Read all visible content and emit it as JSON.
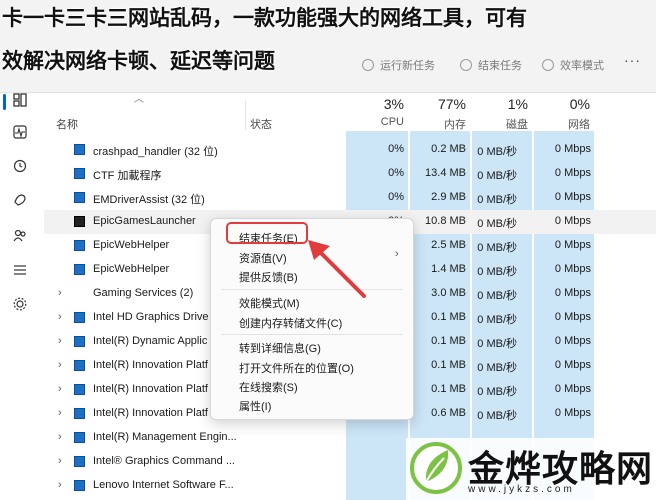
{
  "caption": {
    "line1": "卡一卡三卡三网站乱码，一款功能强大的网络工具，可有",
    "line2": "效解决网络卡顿、延迟等问题"
  },
  "toolbar": {
    "run_task": "运行新任务",
    "end_task": "结束任务",
    "efficiency": "效率模式",
    "more": "···"
  },
  "header": {
    "name": "名称",
    "status": "状态",
    "cpu_pct": "3%",
    "cpu": "CPU",
    "mem_pct": "77%",
    "mem": "内存",
    "disk_pct": "1%",
    "disk": "磁盘",
    "net_pct": "0%",
    "net": "网络"
  },
  "rows": [
    {
      "name": "crashpad_handler (32 位)",
      "cpu": "0%",
      "mem": "0.2 MB",
      "disk": "0 MB/秒",
      "net": "0 Mbps",
      "icon": "app-icon"
    },
    {
      "name": "CTF 加載程序",
      "cpu": "0%",
      "mem": "13.4 MB",
      "disk": "0 MB/秒",
      "net": "0 Mbps",
      "icon": "app-icon"
    },
    {
      "name": "EMDriverAssist (32 位)",
      "cpu": "0%",
      "mem": "2.9 MB",
      "disk": "0 MB/秒",
      "net": "0 Mbps",
      "icon": "app-icon"
    },
    {
      "name": "EpicGamesLauncher",
      "cpu": "0%",
      "mem": "10.8 MB",
      "disk": "0 MB/秒",
      "net": "0 Mbps",
      "icon": "epic-icon"
    },
    {
      "name": "EpicWebHelper",
      "cpu": "",
      "mem": "2.5 MB",
      "disk": "0 MB/秒",
      "net": "0 Mbps",
      "icon": "app-icon"
    },
    {
      "name": "EpicWebHelper",
      "cpu": "",
      "mem": "1.4 MB",
      "disk": "0 MB/秒",
      "net": "0 Mbps",
      "icon": "app-icon"
    },
    {
      "name": "Gaming Services (2)",
      "cpu": "",
      "mem": "3.0 MB",
      "disk": "0 MB/秒",
      "net": "0 Mbps",
      "icon": "none",
      "expand": true
    },
    {
      "name": "Intel HD Graphics Drive",
      "cpu": "",
      "mem": "0.1 MB",
      "disk": "0 MB/秒",
      "net": "0 Mbps",
      "icon": "app-icon",
      "expand": true
    },
    {
      "name": "Intel(R) Dynamic Applic",
      "cpu": "",
      "mem": "0.1 MB",
      "disk": "0 MB/秒",
      "net": "0 Mbps",
      "icon": "app-icon",
      "expand": true
    },
    {
      "name": "Intel(R) Innovation Platf",
      "cpu": "",
      "mem": "0.1 MB",
      "disk": "0 MB/秒",
      "net": "0 Mbps",
      "icon": "app-icon",
      "expand": true
    },
    {
      "name": "Intel(R) Innovation Platf",
      "cpu": "",
      "mem": "0.1 MB",
      "disk": "0 MB/秒",
      "net": "0 Mbps",
      "icon": "app-icon",
      "expand": true
    },
    {
      "name": "Intel(R) Innovation Platf",
      "cpu": "",
      "mem": "0.6 MB",
      "disk": "0 MB/秒",
      "net": "0 Mbps",
      "icon": "app-icon",
      "expand": true
    },
    {
      "name": "Intel(R) Management Engin...",
      "cpu": "",
      "mem": "",
      "disk": "",
      "net": "",
      "icon": "app-icon",
      "expand": true
    },
    {
      "name": "Intel® Graphics Command ...",
      "cpu": "",
      "mem": "",
      "disk": "",
      "net": "",
      "icon": "app-icon",
      "expand": true
    },
    {
      "name": "Lenovo Internet Software F...",
      "cpu": "",
      "mem": "",
      "disk": "",
      "net": "",
      "icon": "app-icon",
      "expand": true
    }
  ],
  "context_menu": {
    "end_task": "结束任务(E)",
    "resource_values": "资源值(V)",
    "feedback": "提供反馈(B)",
    "efficiency_mode": "效能模式(M)",
    "create_dump": "创建内存转储文件(C)",
    "go_details": "转到详细信息(G)",
    "open_location": "打开文件所在的位置(O)",
    "search_online": "在线搜索(S)",
    "properties": "属性(I)"
  },
  "watermark": {
    "text": "金烨攻略网",
    "url": "www.jykzs.com"
  },
  "colors": {
    "highlight_column": "#cce5f7",
    "accent": "#0067c0",
    "red_annotation": "#e23b3b"
  }
}
